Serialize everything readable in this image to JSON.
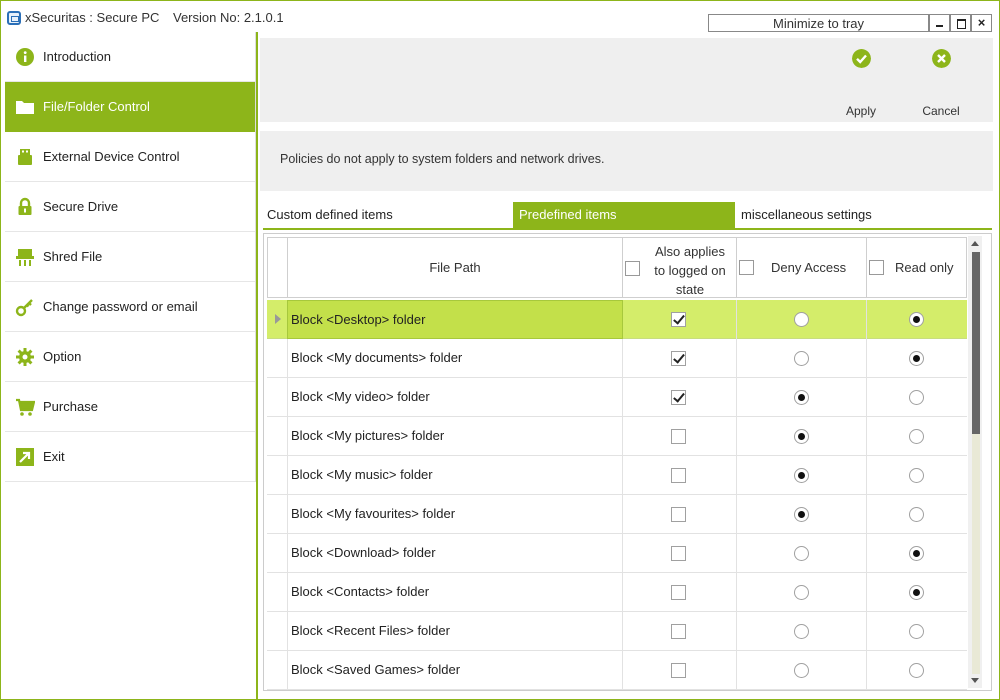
{
  "window": {
    "title": "xSecuritas : Secure PC",
    "version": "Version No: 2.1.0.1",
    "tray_label": "Minimize to tray",
    "close_glyph": "×"
  },
  "colors": {
    "accent": "#8db51a",
    "selected_row": "#d4ed6a",
    "panel_bg": "#efefef"
  },
  "sidebar": {
    "items": [
      {
        "label": "Introduction",
        "icon": "info-icon",
        "active": false
      },
      {
        "label": "File/Folder Control",
        "icon": "folder-icon",
        "active": true
      },
      {
        "label": "External Device Control",
        "icon": "usb-icon",
        "active": false
      },
      {
        "label": "Secure Drive",
        "icon": "lock-icon",
        "active": false
      },
      {
        "label": "Shred File",
        "icon": "shredder-icon",
        "active": false
      },
      {
        "label": "Change password or email",
        "icon": "key-icon",
        "active": false
      },
      {
        "label": "Option",
        "icon": "gear-icon",
        "active": false
      },
      {
        "label": "Purchase",
        "icon": "cart-icon",
        "active": false
      },
      {
        "label": "Exit",
        "icon": "exit-icon",
        "active": false
      }
    ]
  },
  "toolbar": {
    "apply_label": "Apply",
    "cancel_label": "Cancel"
  },
  "notice": "Policies do not apply to system folders and network drives.",
  "tabs": [
    {
      "label": "Custom defined items",
      "active": false
    },
    {
      "label": "Predefined items",
      "active": true
    },
    {
      "label": "miscellaneous settings",
      "active": false
    }
  ],
  "table": {
    "columns": {
      "path": "File Path",
      "logged": "Also applies to logged on state",
      "deny": "Deny Access",
      "read": "Read only"
    },
    "rows": [
      {
        "path": "Block <Desktop> folder",
        "logged": true,
        "access": "read",
        "selected": true
      },
      {
        "path": "Block <My documents> folder",
        "logged": true,
        "access": "read"
      },
      {
        "path": "Block <My video> folder",
        "logged": true,
        "access": "deny"
      },
      {
        "path": "Block <My pictures> folder",
        "logged": false,
        "access": "deny"
      },
      {
        "path": "Block <My music> folder",
        "logged": false,
        "access": "deny"
      },
      {
        "path": "Block <My favourites> folder",
        "logged": false,
        "access": "deny"
      },
      {
        "path": "Block <Download> folder",
        "logged": false,
        "access": "read"
      },
      {
        "path": "Block <Contacts> folder",
        "logged": false,
        "access": "read"
      },
      {
        "path": "Block <Recent Files> folder",
        "logged": false,
        "access": "none"
      },
      {
        "path": "Block <Saved Games> folder",
        "logged": false,
        "access": "none"
      }
    ]
  }
}
